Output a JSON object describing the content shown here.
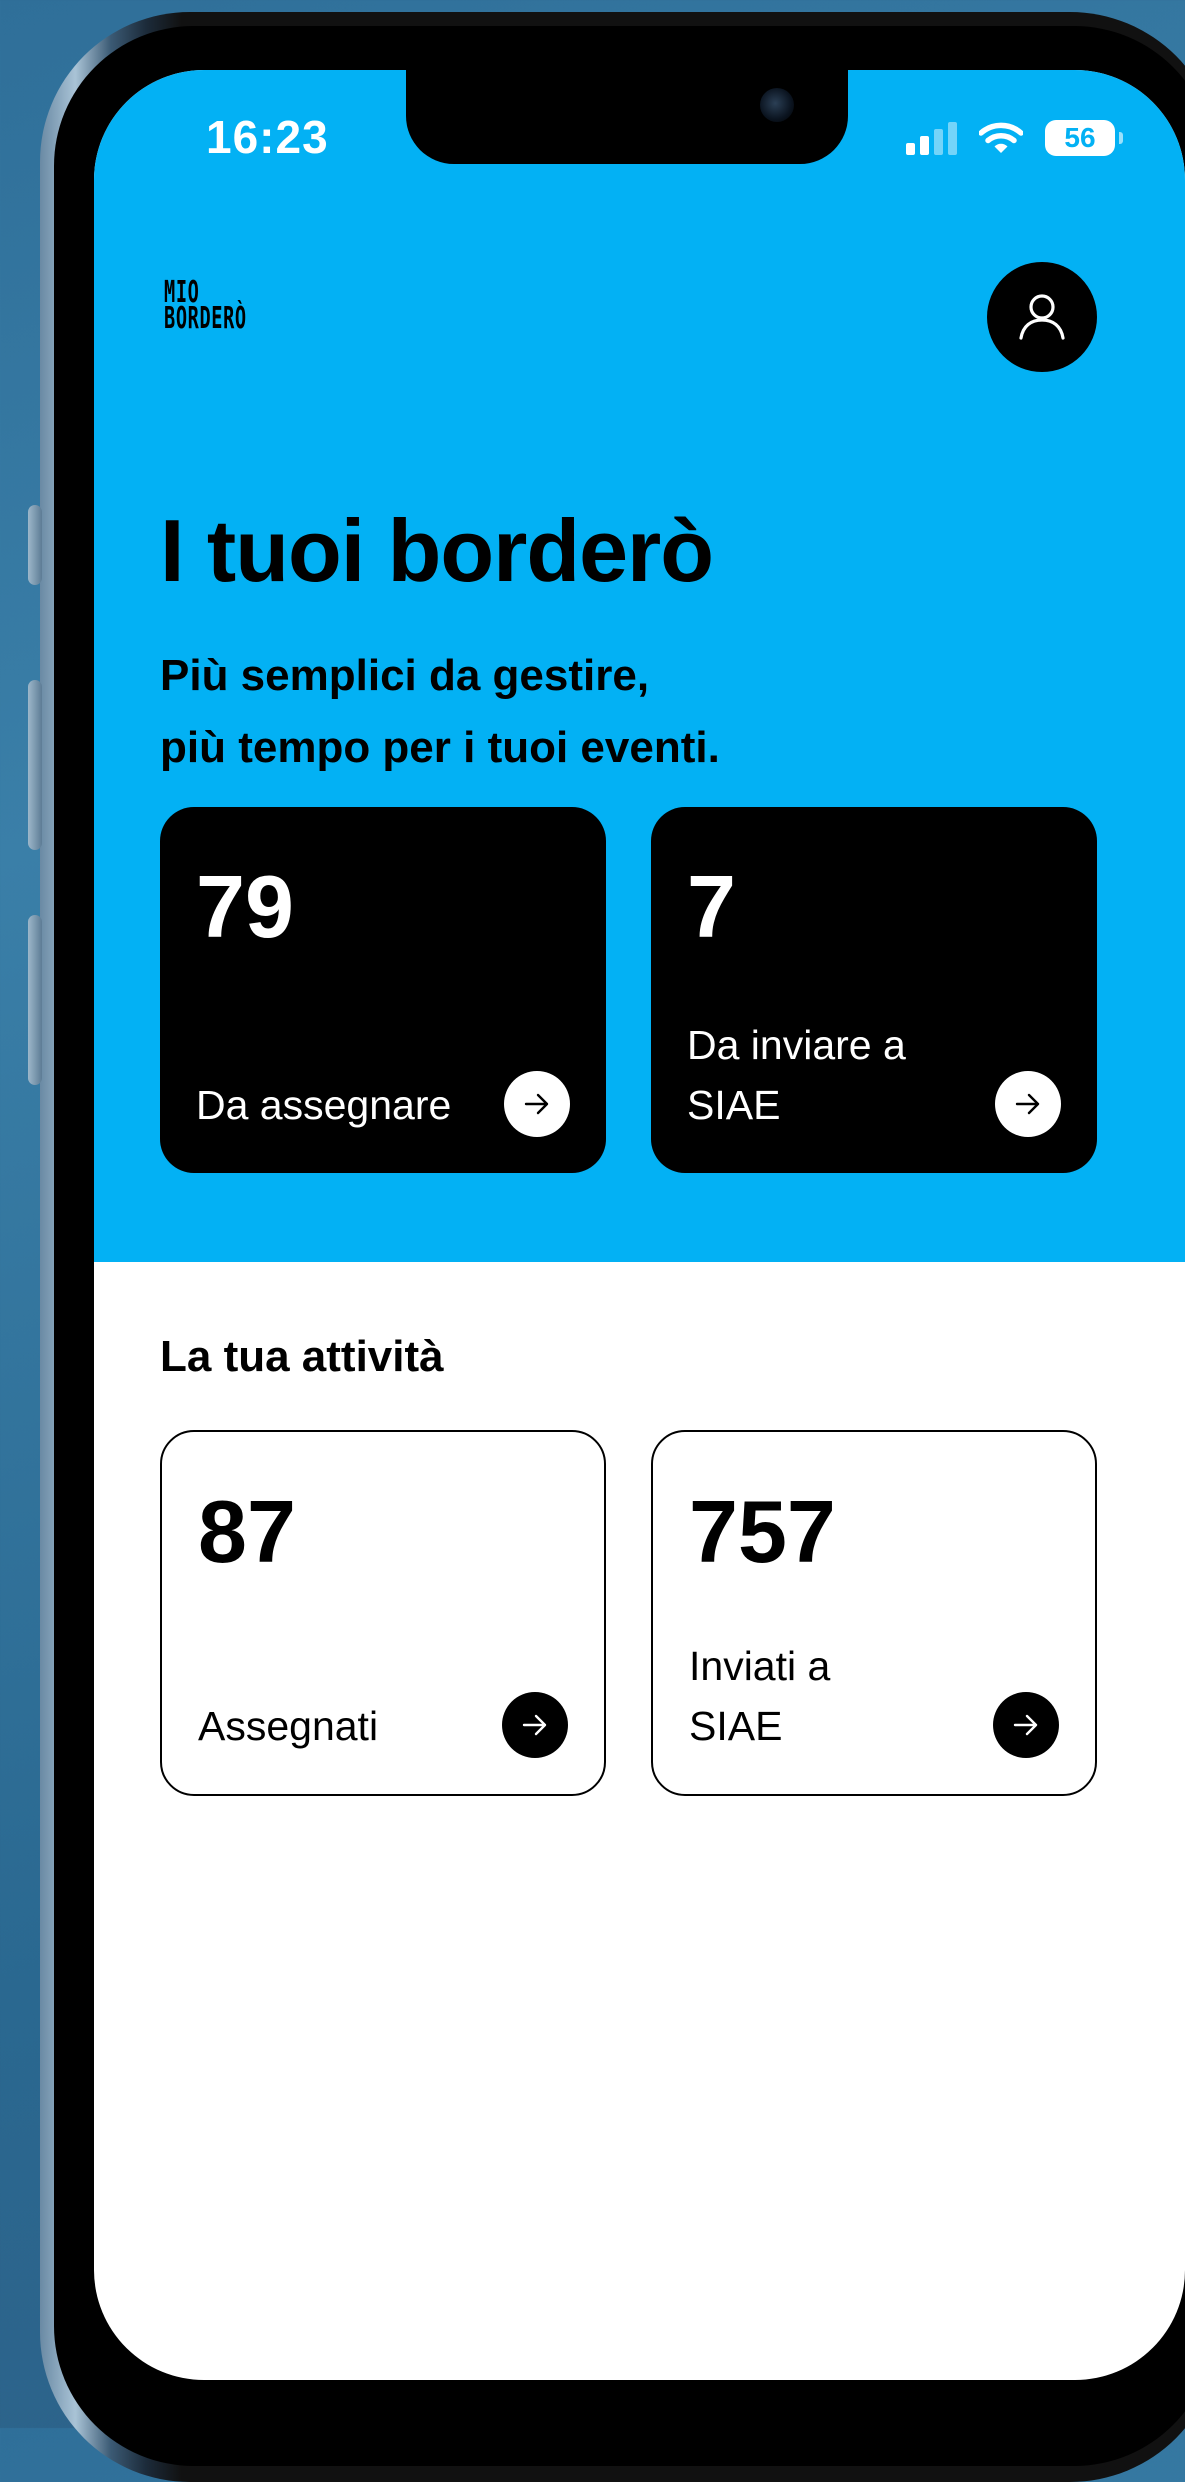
{
  "status_bar": {
    "time": "16:23",
    "battery": "56"
  },
  "header": {
    "logo_line1": "MIO",
    "logo_line2": "BORDERÒ"
  },
  "hero": {
    "title": "I tuoi borderò",
    "subtitle_line1": "Più semplici da gestire,",
    "subtitle_line2": "più tempo per i tuoi eventi."
  },
  "pending_cards": [
    {
      "value": "79",
      "label": "Da assegnare"
    },
    {
      "value": "7",
      "label": "Da inviare a SIAE"
    }
  ],
  "activity": {
    "title": "La tua attività",
    "cards": [
      {
        "value": "87",
        "label": "Assegnati"
      },
      {
        "value": "757",
        "label": "Inviati a SIAE"
      }
    ]
  },
  "colors": {
    "accent": "#03b1f4",
    "card_dark": "#000000",
    "background": "#ffffff"
  },
  "icons": {
    "profile": "user-icon",
    "arrow": "arrow-right-icon",
    "wifi": "wifi-icon",
    "signal": "cellular-signal-icon",
    "battery": "battery-icon"
  }
}
